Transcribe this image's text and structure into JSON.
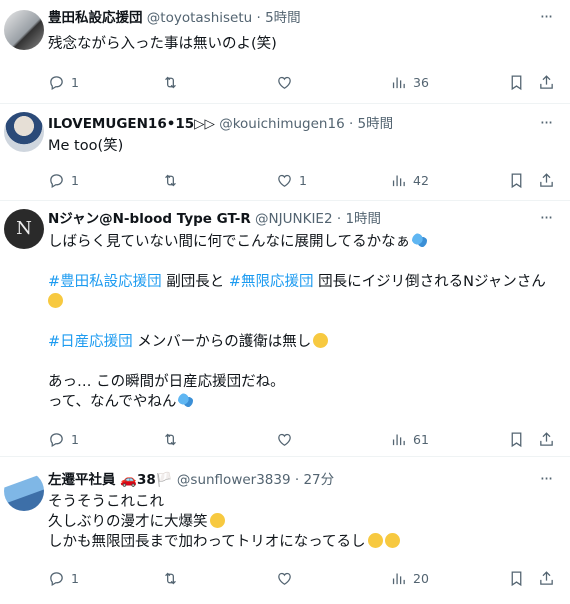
{
  "tweets": [
    {
      "name": "豊田私設応援団",
      "handle": "@toyotashisetu",
      "time": "5時間",
      "lines": [
        "残念ながら入った事は無いのよ(笑)"
      ],
      "counts": {
        "reply": "1",
        "retweet": "",
        "like": "",
        "views": "36"
      }
    },
    {
      "name": "ILOVEMUGEN16•15▷▷",
      "handle": "@kouichimugen16",
      "time": "5時間",
      "lines": [
        "Me too(笑)"
      ],
      "counts": {
        "reply": "1",
        "retweet": "",
        "like": "1",
        "views": "42"
      }
    },
    {
      "name": "Nジャン@N-blood Type GT-R",
      "handle": "@NJUNKIE2",
      "time": "1時間",
      "line1": "しばらく見ていない間に何でこんなに展開してるかなぁ",
      "hashtag1": "#豊田私設応援団",
      "mid1": " 副団長と ",
      "hashtag2": "#無限応援団",
      "mid2": " 団長にイジリ倒されるNジャンさん",
      "hashtag3": "#日産応援団",
      "mid3": " メンバーからの護衛は無し",
      "line4": "あっ… この瞬間が日産応援団だね。",
      "line5": "って、なんでやねん",
      "counts": {
        "reply": "1",
        "retweet": "",
        "like": "",
        "views": "61"
      }
    },
    {
      "name": "左遷平社員 🚗38🏳️",
      "handle": "@sunflower3839",
      "time": "27分",
      "lines": [
        "そうそうこれこれ",
        "久しぶりの漫才に大爆笑",
        "しかも無限団長まで加わってトリオになってるし"
      ],
      "counts": {
        "reply": "1",
        "retweet": "",
        "like": "",
        "views": "20"
      }
    }
  ],
  "separator": "·",
  "more_glyph": "···",
  "avatar3_letter": "N",
  "colors": {
    "link": "#1d9bf0",
    "muted": "#536471",
    "text": "#0f1419"
  },
  "icons": [
    "reply-icon",
    "retweet-icon",
    "like-icon",
    "views-icon",
    "bookmark-icon",
    "share-icon",
    "more-icon"
  ]
}
